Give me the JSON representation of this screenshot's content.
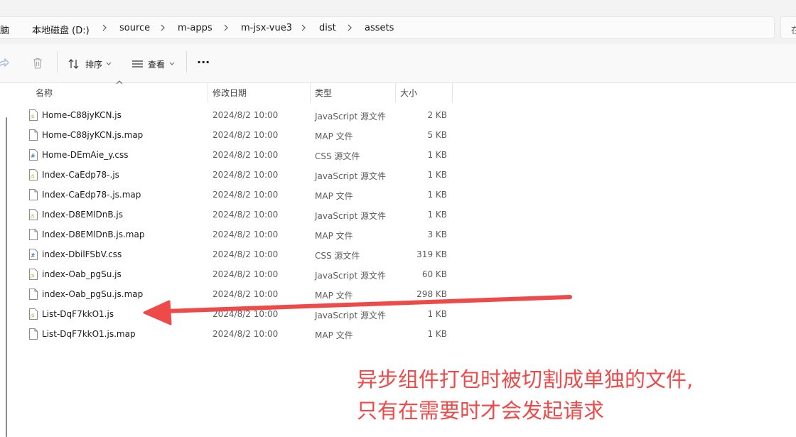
{
  "breadcrumb": {
    "partial_first": "脑",
    "items": [
      "本地磁盘 (D:)",
      "source",
      "m-apps",
      "m-jsx-vue3",
      "dist",
      "assets"
    ],
    "search_hint": "在"
  },
  "toolbar": {
    "sort_label": "排序",
    "view_label": "查看",
    "more_label": "···"
  },
  "columns": {
    "name": "名称",
    "date": "修改日期",
    "type": "类型",
    "size": "大小"
  },
  "files": [
    {
      "name": "Home-C88jyKCN.js",
      "date": "2024/8/2 10:00",
      "type": "JavaScript 源文件",
      "size": "2 KB",
      "icon": "js-file-icon"
    },
    {
      "name": "Home-C88jyKCN.js.map",
      "date": "2024/8/2 10:00",
      "type": "MAP 文件",
      "size": "5 KB",
      "icon": "map-file-icon"
    },
    {
      "name": "Home-DEmAie_y.css",
      "date": "2024/8/2 10:00",
      "type": "CSS 源文件",
      "size": "1 KB",
      "icon": "css-file-icon"
    },
    {
      "name": "Index-CaEdp78-.js",
      "date": "2024/8/2 10:00",
      "type": "JavaScript 源文件",
      "size": "1 KB",
      "icon": "js-file-icon"
    },
    {
      "name": "Index-CaEdp78-.js.map",
      "date": "2024/8/2 10:00",
      "type": "MAP 文件",
      "size": "1 KB",
      "icon": "map-file-icon"
    },
    {
      "name": "Index-D8EMlDnB.js",
      "date": "2024/8/2 10:00",
      "type": "JavaScript 源文件",
      "size": "1 KB",
      "icon": "js-file-icon"
    },
    {
      "name": "Index-D8EMlDnB.js.map",
      "date": "2024/8/2 10:00",
      "type": "MAP 文件",
      "size": "3 KB",
      "icon": "map-file-icon"
    },
    {
      "name": "index-DbilFSbV.css",
      "date": "2024/8/2 10:00",
      "type": "CSS 源文件",
      "size": "319 KB",
      "icon": "css-file-icon"
    },
    {
      "name": "index-Oab_pgSu.js",
      "date": "2024/8/2 10:00",
      "type": "JavaScript 源文件",
      "size": "60 KB",
      "icon": "js-file-icon"
    },
    {
      "name": "index-Oab_pgSu.js.map",
      "date": "2024/8/2 10:00",
      "type": "MAP 文件",
      "size": "298 KB",
      "icon": "map-file-icon"
    },
    {
      "name": "List-DqF7kkO1.js",
      "date": "2024/8/2 10:00",
      "type": "JavaScript 源文件",
      "size": "1 KB",
      "icon": "js-file-icon"
    },
    {
      "name": "List-DqF7kkO1.js.map",
      "date": "2024/8/2 10:00",
      "type": "MAP 文件",
      "size": "1 KB",
      "icon": "map-file-icon"
    }
  ],
  "annotation": {
    "line1": "异步组件打包时被切割成单独的文件,",
    "line2": "只有在需要时才会发起请求",
    "color": "#ef4a4a"
  }
}
